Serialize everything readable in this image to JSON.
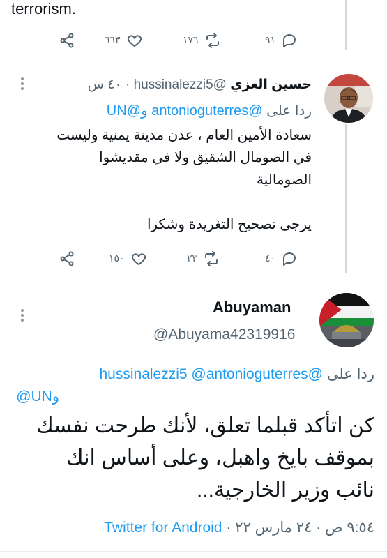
{
  "top_snippet": "terrorism.",
  "tweet0_stats": {
    "replies": "٩١",
    "retweets": "١٧٦",
    "likes": "٦٦٣"
  },
  "tweet1": {
    "name": "حسين العزي",
    "handle": "@hussinalezzi5",
    "time": "٤٠ س",
    "reply_prefix": "ردا على",
    "mention_a": "@antonioguterres",
    "conj": "و",
    "mention_b": "@UN",
    "line1": "سعادة الأمين العام ، عدن مدينة يمنية وليست",
    "line2": "في الصومال الشقيق ولا في مقديشوا",
    "line3": "الصومالية",
    "line4": "يرجى  تصحيح التغريدة وشكرا",
    "stats": {
      "replies": "٤٠",
      "retweets": "٢٣",
      "likes": "١٥٠"
    }
  },
  "tweet2": {
    "name": "Abuyaman",
    "handle": "@Abuyama42319916",
    "reply_prefix": "ردا على",
    "mention_a": "@hussinalezzi5",
    "mention_b": "@antonioguterres",
    "conj": "و",
    "mention_c": "@UN",
    "line1": "كن اتأكد قبلما تعلق،  لأنك طرحت نفسك",
    "line2": "بموقف بايخ واهبل، وعلى أساس انك",
    "line3": "نائب وزير الخارجية...",
    "time": "٩:٥٤ ص",
    "sep": "·",
    "date": "٢٤ مارس ٢٢",
    "source": "Twitter for Android"
  },
  "colors": {
    "link": "#1d9bf0",
    "muted": "#536471",
    "text": "#0f1419"
  },
  "icons": [
    "reply-icon",
    "retweet-icon",
    "like-icon",
    "share-icon",
    "more-icon"
  ]
}
